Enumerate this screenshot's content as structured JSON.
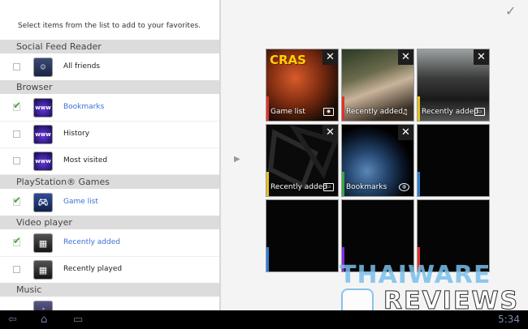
{
  "instruction": "Select items from the list to add to your favorites.",
  "list": [
    {
      "category": "Social Feed Reader",
      "items": [
        {
          "label": "All friends",
          "checked": false,
          "icon": "friends-icon"
        }
      ]
    },
    {
      "category": "Browser",
      "items": [
        {
          "label": "Bookmarks",
          "checked": true,
          "icon": "www-icon"
        },
        {
          "label": "History",
          "checked": false,
          "icon": "www-icon"
        },
        {
          "label": "Most visited",
          "checked": false,
          "icon": "www-icon"
        }
      ]
    },
    {
      "category": "PlayStation® Games",
      "items": [
        {
          "label": "Game list",
          "checked": true,
          "icon": "gamepad-icon"
        }
      ]
    },
    {
      "category": "Video player",
      "items": [
        {
          "label": "Recently added",
          "checked": true,
          "icon": "film-icon"
        },
        {
          "label": "Recently played",
          "checked": false,
          "icon": "film-icon"
        }
      ]
    },
    {
      "category": "Music",
      "items": []
    }
  ],
  "tiles": [
    {
      "label": "Game list",
      "accent": "#e0322a",
      "closable": true,
      "badge": "gamepad-icon"
    },
    {
      "label": "Recently added",
      "accent": "#e0322a",
      "closable": true,
      "badge": "music-note-icon"
    },
    {
      "label": "Recently added",
      "accent": "#e8c21f",
      "closable": true,
      "badge": "tv-icon"
    },
    {
      "label": "Recently added",
      "accent": "#e8c21f",
      "closable": true,
      "badge": "tv-icon"
    },
    {
      "label": "Bookmarks",
      "accent": "#3aa644",
      "closable": true,
      "badge": "globe-icon"
    },
    {
      "label": "",
      "accent": "#2c7fd6",
      "closable": false,
      "badge": ""
    },
    {
      "label": "",
      "accent": "#2c7fd6",
      "closable": false,
      "badge": ""
    },
    {
      "label": "",
      "accent": "#8a2be2",
      "closable": false,
      "badge": ""
    },
    {
      "label": "",
      "accent": "#e0322a",
      "closable": false,
      "badge": ""
    }
  ],
  "status": {
    "time": "5:34"
  },
  "watermark": {
    "line1": "THAIWARE",
    "line2": "REVIEWS"
  }
}
